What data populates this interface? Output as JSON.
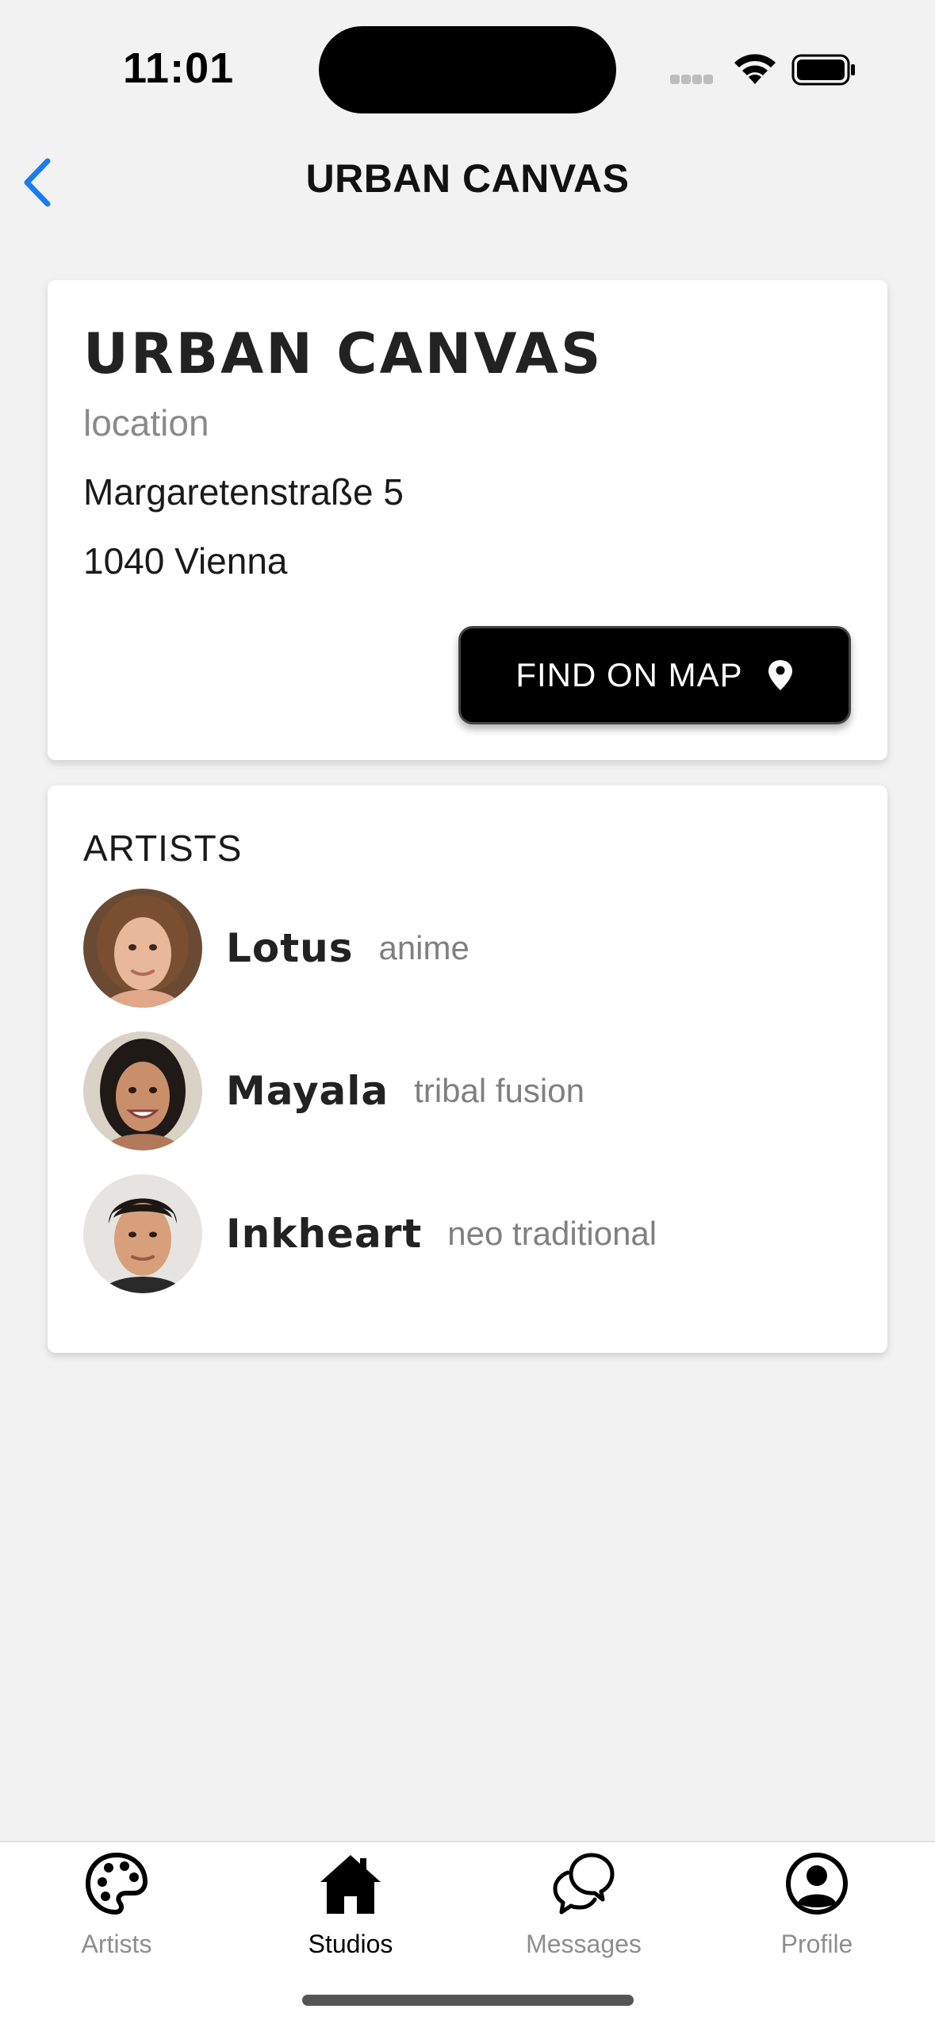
{
  "status_bar": {
    "time": "11:01"
  },
  "nav": {
    "title": "URBAN CANVAS"
  },
  "studio": {
    "name": "URBAN CANVAS",
    "location_label": "location",
    "address_line1": "Margaretenstraße 5",
    "address_line2": "1040 Vienna",
    "map_button_label": "FIND ON MAP"
  },
  "artists": {
    "heading": "ARTISTS",
    "items": [
      {
        "name": "Lotus",
        "style": "anime"
      },
      {
        "name": "Mayala",
        "style": "tribal fusion"
      },
      {
        "name": "Inkheart",
        "style": "neo traditional"
      }
    ]
  },
  "tabs": [
    {
      "label": "Artists",
      "icon": "palette-icon",
      "active": false
    },
    {
      "label": "Studios",
      "icon": "home-icon",
      "active": true
    },
    {
      "label": "Messages",
      "icon": "chat-bubbles-icon",
      "active": false
    },
    {
      "label": "Profile",
      "icon": "user-circle-icon",
      "active": false
    }
  ],
  "colors": {
    "accent": "#1a7cf0",
    "button_bg": "#000000",
    "background": "#f2f2f2"
  }
}
